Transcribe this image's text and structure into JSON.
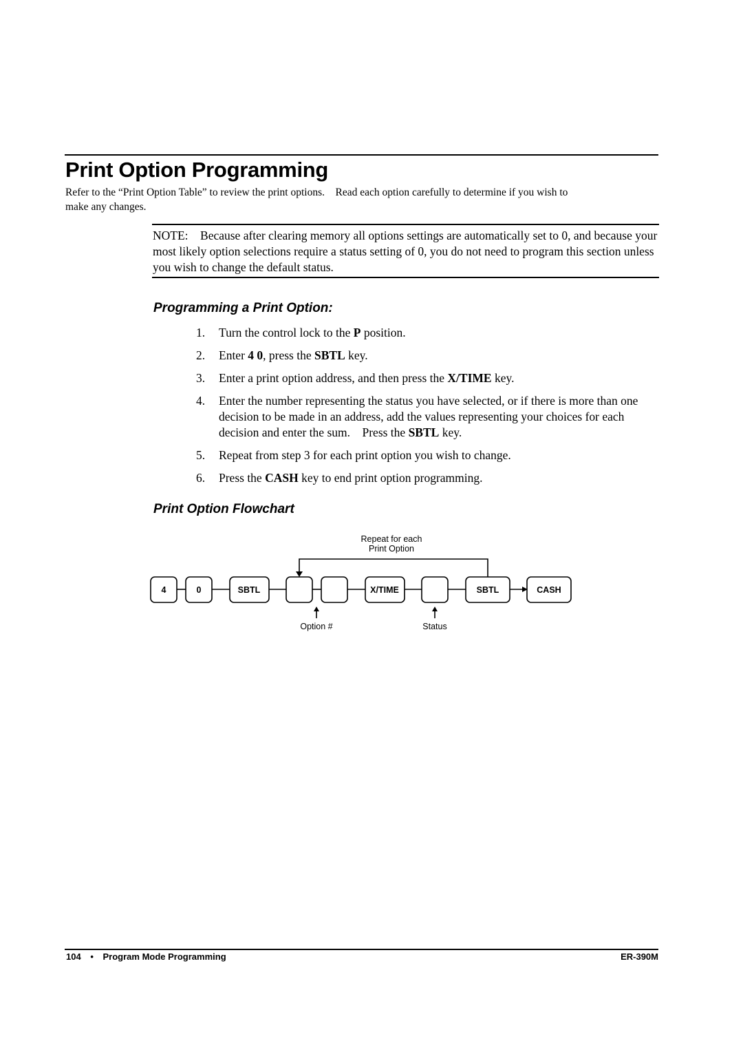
{
  "page": {
    "title": "Print Option Programming",
    "intro_line1": "Refer to the “Print Option Table” to review the print options.    Read each option carefully to determine if you wish to",
    "intro_line2": "make any changes.",
    "note": "NOTE:    Because after clearing memory all options settings are automatically set to 0, and because your most likely option selections require a status setting of 0, you do not need to program this section unless you wish to change the default status."
  },
  "section_programming": {
    "heading": "Programming a Print Option:",
    "steps": [
      {
        "num": "1.",
        "parts": [
          "Turn the control lock to the ",
          "P",
          " position."
        ]
      },
      {
        "num": "2.",
        "parts": [
          "Enter ",
          "4 0",
          ", press the ",
          "SBTL",
          " key."
        ]
      },
      {
        "num": "3.",
        "parts": [
          "Enter a print option address, and then press the ",
          "X/TIME",
          " key."
        ]
      },
      {
        "num": "4.",
        "parts": [
          "Enter the number representing the status you have selected, or if there is more than one decision to be made in an address, add the values representing your choices for each decision and enter the sum.    Press the ",
          "SBTL",
          " key."
        ]
      },
      {
        "num": "5.",
        "parts": [
          "Repeat from step 3 for each print option you wish to change."
        ]
      },
      {
        "num": "6.",
        "parts": [
          "Press the ",
          "CASH",
          " key to end print option programming."
        ]
      }
    ]
  },
  "section_flowchart": {
    "heading": "Print Option Flowchart",
    "loop_label_line1": "Repeat for each",
    "loop_label_line2": "Print Option",
    "keys": [
      "4",
      "0",
      "SBTL",
      "",
      "",
      "X/TIME",
      "",
      "SBTL",
      "CASH"
    ],
    "option_label": "Option #",
    "status_label": "Status"
  },
  "footer": {
    "page_number": "104",
    "bullet": "•",
    "section": "Program Mode Programming",
    "model": "ER-390M"
  }
}
